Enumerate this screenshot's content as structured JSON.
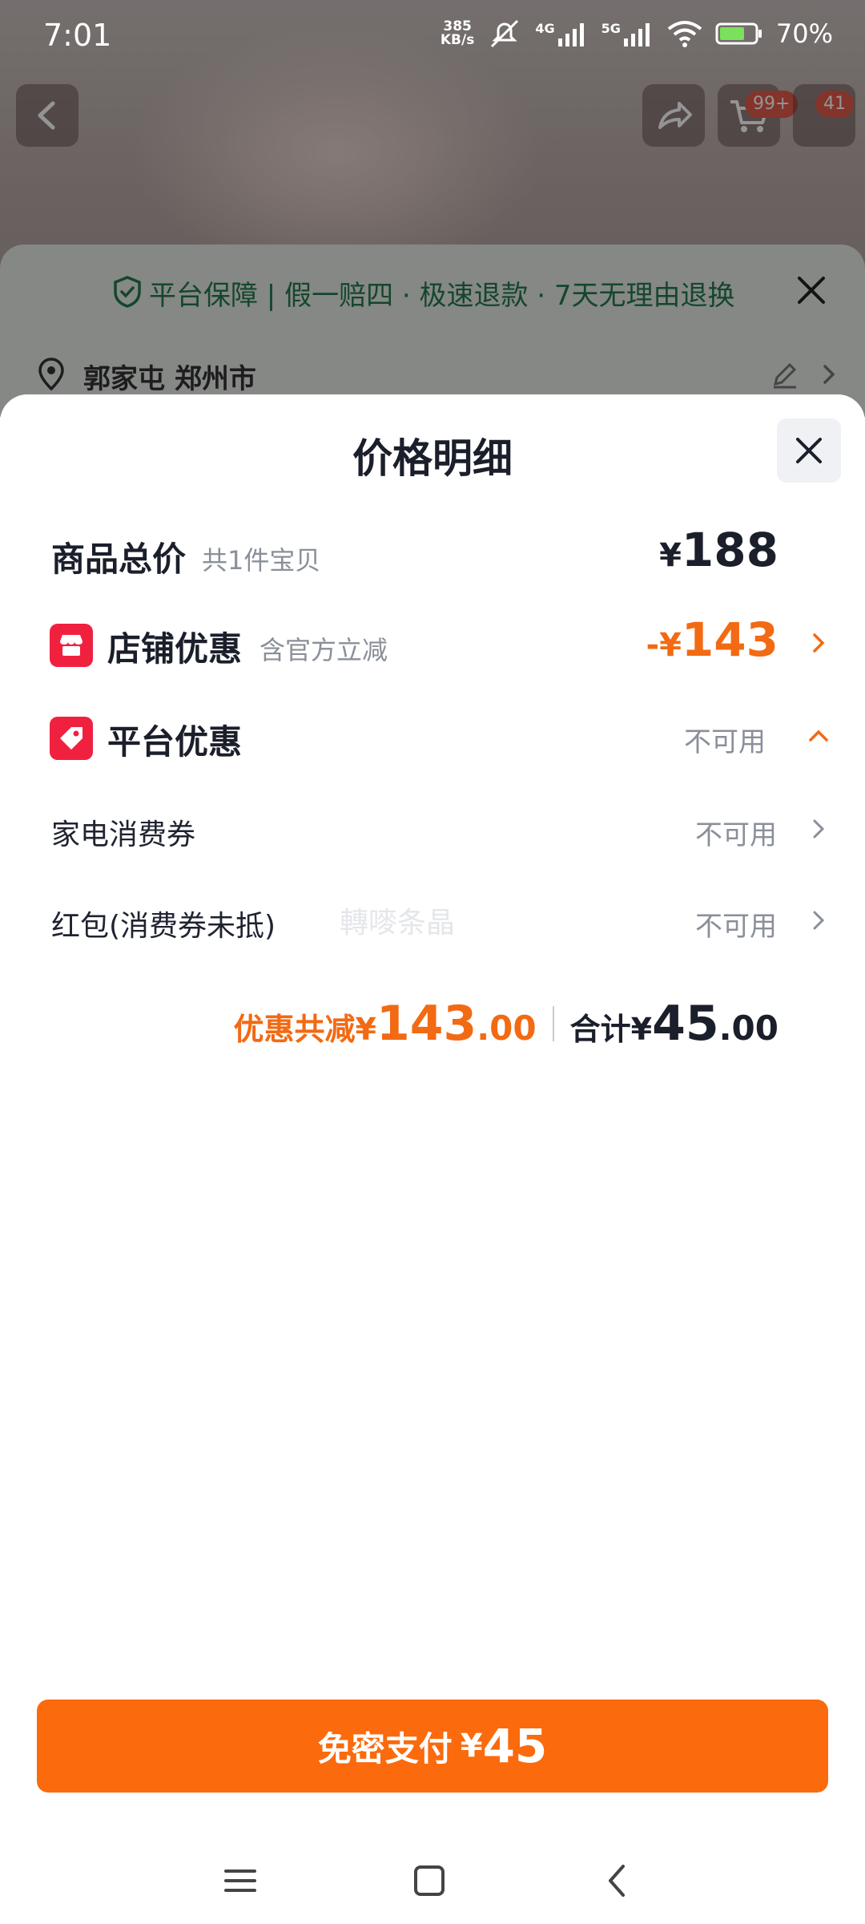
{
  "status_bar": {
    "time": "7:01",
    "net_speed_value": "385",
    "net_speed_unit": "KB/s",
    "signal_4g": "4G",
    "signal_5g": "5G",
    "battery": "70%"
  },
  "background_page": {
    "cart_badge": "99+",
    "message_badge": "41",
    "guarantee_text": "平台保障 | 假一赔四 · 极速退款 · 7天无理由退换",
    "address": "郭家屯 郑州市"
  },
  "price_detail": {
    "title": "价格明细",
    "goods_total": {
      "label": "商品总价",
      "sub": "共1件宝贝",
      "currency": "¥",
      "amount": "188"
    },
    "shop_discount": {
      "label": "店铺优惠",
      "sub": "含官方立减",
      "prefix": "-",
      "currency": "¥",
      "amount": "143"
    },
    "platform_discount": {
      "label": "平台优惠",
      "status": "不可用"
    },
    "appliance_coupon": {
      "label": "家电消费券",
      "status": "不可用"
    },
    "red_packet": {
      "label": "红包(消费券未抵)",
      "status": "不可用"
    },
    "watermark": "轉嘜条晶",
    "summary": {
      "discount_label": "优惠共减",
      "discount_currency": "¥",
      "discount_int": "143",
      "discount_dec": ".00",
      "total_label": "合计",
      "total_currency": "¥",
      "total_int": "45",
      "total_dec": ".00"
    },
    "pay_button": {
      "label": "免密支付",
      "currency": "¥",
      "amount": "45"
    }
  },
  "colors": {
    "accent_orange": "#fb6a0c",
    "discount_orange": "#f26a13",
    "icon_red": "#f0213f",
    "guarantee_green": "#25794c"
  },
  "icons": [
    "location-icon",
    "edit-icon",
    "shield-check-icon",
    "shop-icon",
    "coupon-tag-icon",
    "close-icon",
    "chevron-right-icon",
    "chevron-up-icon",
    "menu-icon",
    "home-square-icon",
    "back-icon",
    "share-icon",
    "cart-icon"
  ]
}
